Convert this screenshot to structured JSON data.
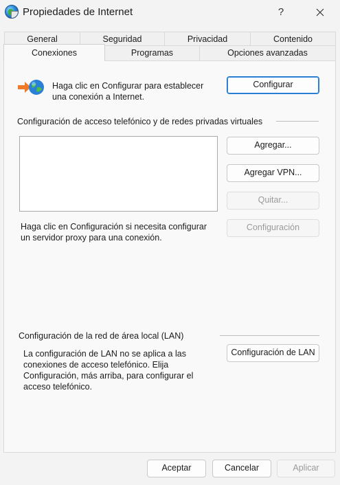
{
  "window": {
    "title": "Propiedades de Internet",
    "help_label": "?",
    "icon": "internet-options-globe-icon"
  },
  "tabs": {
    "row1": [
      "General",
      "Seguridad",
      "Privacidad",
      "Contenido"
    ],
    "row2": [
      "Conexiones",
      "Programas",
      "Opciones avanzadas"
    ],
    "active": "Conexiones"
  },
  "setup": {
    "text": "Haga clic en Configurar para establecer una conexión a Internet.",
    "button": "Configurar",
    "icon": "network-connect-icon"
  },
  "dialup": {
    "heading": "Configuración de acceso telefónico y de redes privadas virtuales",
    "add_button": "Agregar...",
    "add_vpn_button": "Agregar VPN...",
    "remove_button": "Quitar...",
    "settings_button": "Configuración",
    "proxy_text": "Haga clic en Configuración si necesita configurar un servidor proxy para una conexión."
  },
  "lan": {
    "heading": "Configuración de la red de área local (LAN)",
    "text": "La configuración de LAN no se aplica a las conexiones de acceso telefónico. Elija Configuración, más arriba, para configurar el acceso telefónico.",
    "button": "Configuración de LAN"
  },
  "footer": {
    "ok": "Aceptar",
    "cancel": "Cancelar",
    "apply": "Aplicar"
  },
  "colors": {
    "accent": "#1a73c8",
    "disabled_text": "#9a9a9a"
  }
}
